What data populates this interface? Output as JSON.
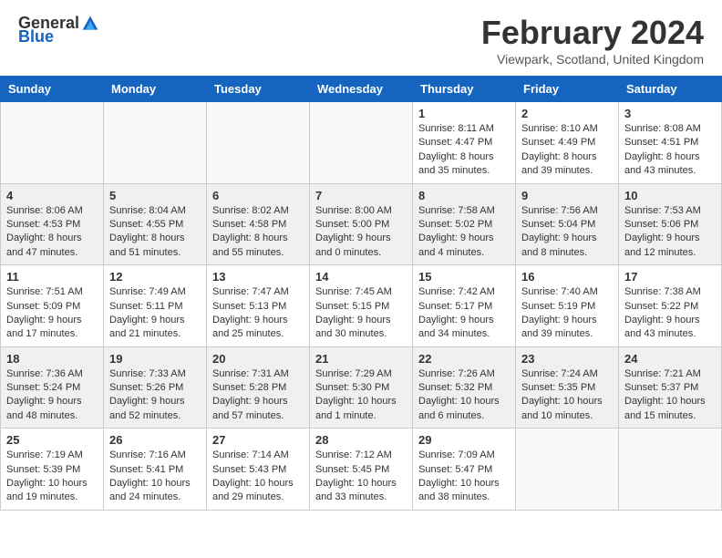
{
  "header": {
    "logo_general": "General",
    "logo_blue": "Blue",
    "month_title": "February 2024",
    "location": "Viewpark, Scotland, United Kingdom"
  },
  "days_of_week": [
    "Sunday",
    "Monday",
    "Tuesday",
    "Wednesday",
    "Thursday",
    "Friday",
    "Saturday"
  ],
  "weeks": [
    {
      "shade": "white",
      "days": [
        {
          "num": "",
          "data": ""
        },
        {
          "num": "",
          "data": ""
        },
        {
          "num": "",
          "data": ""
        },
        {
          "num": "",
          "data": ""
        },
        {
          "num": "1",
          "data": "Sunrise: 8:11 AM\nSunset: 4:47 PM\nDaylight: 8 hours and 35 minutes."
        },
        {
          "num": "2",
          "data": "Sunrise: 8:10 AM\nSunset: 4:49 PM\nDaylight: 8 hours and 39 minutes."
        },
        {
          "num": "3",
          "data": "Sunrise: 8:08 AM\nSunset: 4:51 PM\nDaylight: 8 hours and 43 minutes."
        }
      ]
    },
    {
      "shade": "shade",
      "days": [
        {
          "num": "4",
          "data": "Sunrise: 8:06 AM\nSunset: 4:53 PM\nDaylight: 8 hours and 47 minutes."
        },
        {
          "num": "5",
          "data": "Sunrise: 8:04 AM\nSunset: 4:55 PM\nDaylight: 8 hours and 51 minutes."
        },
        {
          "num": "6",
          "data": "Sunrise: 8:02 AM\nSunset: 4:58 PM\nDaylight: 8 hours and 55 minutes."
        },
        {
          "num": "7",
          "data": "Sunrise: 8:00 AM\nSunset: 5:00 PM\nDaylight: 9 hours and 0 minutes."
        },
        {
          "num": "8",
          "data": "Sunrise: 7:58 AM\nSunset: 5:02 PM\nDaylight: 9 hours and 4 minutes."
        },
        {
          "num": "9",
          "data": "Sunrise: 7:56 AM\nSunset: 5:04 PM\nDaylight: 9 hours and 8 minutes."
        },
        {
          "num": "10",
          "data": "Sunrise: 7:53 AM\nSunset: 5:06 PM\nDaylight: 9 hours and 12 minutes."
        }
      ]
    },
    {
      "shade": "white",
      "days": [
        {
          "num": "11",
          "data": "Sunrise: 7:51 AM\nSunset: 5:09 PM\nDaylight: 9 hours and 17 minutes."
        },
        {
          "num": "12",
          "data": "Sunrise: 7:49 AM\nSunset: 5:11 PM\nDaylight: 9 hours and 21 minutes."
        },
        {
          "num": "13",
          "data": "Sunrise: 7:47 AM\nSunset: 5:13 PM\nDaylight: 9 hours and 25 minutes."
        },
        {
          "num": "14",
          "data": "Sunrise: 7:45 AM\nSunset: 5:15 PM\nDaylight: 9 hours and 30 minutes."
        },
        {
          "num": "15",
          "data": "Sunrise: 7:42 AM\nSunset: 5:17 PM\nDaylight: 9 hours and 34 minutes."
        },
        {
          "num": "16",
          "data": "Sunrise: 7:40 AM\nSunset: 5:19 PM\nDaylight: 9 hours and 39 minutes."
        },
        {
          "num": "17",
          "data": "Sunrise: 7:38 AM\nSunset: 5:22 PM\nDaylight: 9 hours and 43 minutes."
        }
      ]
    },
    {
      "shade": "shade",
      "days": [
        {
          "num": "18",
          "data": "Sunrise: 7:36 AM\nSunset: 5:24 PM\nDaylight: 9 hours and 48 minutes."
        },
        {
          "num": "19",
          "data": "Sunrise: 7:33 AM\nSunset: 5:26 PM\nDaylight: 9 hours and 52 minutes."
        },
        {
          "num": "20",
          "data": "Sunrise: 7:31 AM\nSunset: 5:28 PM\nDaylight: 9 hours and 57 minutes."
        },
        {
          "num": "21",
          "data": "Sunrise: 7:29 AM\nSunset: 5:30 PM\nDaylight: 10 hours and 1 minute."
        },
        {
          "num": "22",
          "data": "Sunrise: 7:26 AM\nSunset: 5:32 PM\nDaylight: 10 hours and 6 minutes."
        },
        {
          "num": "23",
          "data": "Sunrise: 7:24 AM\nSunset: 5:35 PM\nDaylight: 10 hours and 10 minutes."
        },
        {
          "num": "24",
          "data": "Sunrise: 7:21 AM\nSunset: 5:37 PM\nDaylight: 10 hours and 15 minutes."
        }
      ]
    },
    {
      "shade": "white",
      "days": [
        {
          "num": "25",
          "data": "Sunrise: 7:19 AM\nSunset: 5:39 PM\nDaylight: 10 hours and 19 minutes."
        },
        {
          "num": "26",
          "data": "Sunrise: 7:16 AM\nSunset: 5:41 PM\nDaylight: 10 hours and 24 minutes."
        },
        {
          "num": "27",
          "data": "Sunrise: 7:14 AM\nSunset: 5:43 PM\nDaylight: 10 hours and 29 minutes."
        },
        {
          "num": "28",
          "data": "Sunrise: 7:12 AM\nSunset: 5:45 PM\nDaylight: 10 hours and 33 minutes."
        },
        {
          "num": "29",
          "data": "Sunrise: 7:09 AM\nSunset: 5:47 PM\nDaylight: 10 hours and 38 minutes."
        },
        {
          "num": "",
          "data": ""
        },
        {
          "num": "",
          "data": ""
        }
      ]
    }
  ]
}
